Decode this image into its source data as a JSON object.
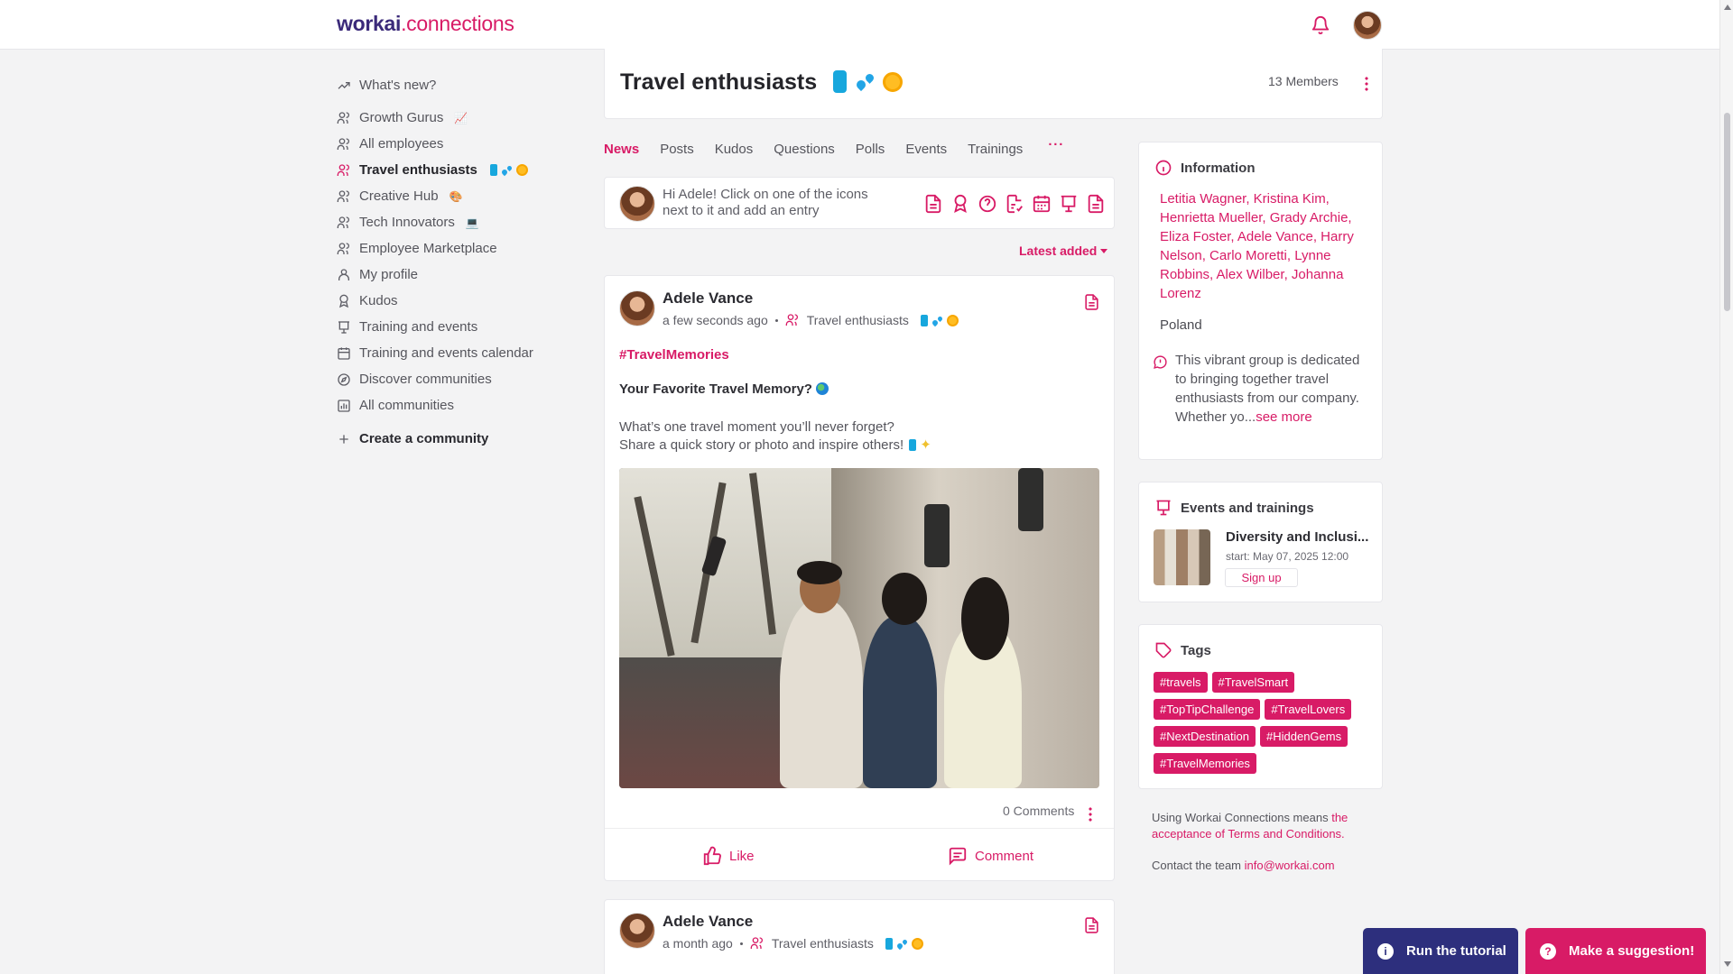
{
  "app": {
    "logo_primary": "workai",
    "logo_secondary": ".connections"
  },
  "header": {
    "icons": [
      "bell-icon",
      "user-avatar"
    ]
  },
  "sidebar": {
    "items": [
      {
        "label": "What's new?",
        "icon": "trend-icon"
      },
      {
        "label": "Growth Gurus",
        "icon": "group-icon",
        "emoji": "📈"
      },
      {
        "label": "All employees",
        "icon": "group-icon"
      },
      {
        "label": "Travel enthusiasts",
        "icon": "group-icon",
        "active": true
      },
      {
        "label": "Creative Hub",
        "icon": "group-icon",
        "emoji": "🎨"
      },
      {
        "label": "Tech Innovators",
        "icon": "group-icon",
        "emoji": "💻"
      },
      {
        "label": "Employee Marketplace",
        "icon": "group-icon"
      },
      {
        "label": "My profile",
        "icon": "user-icon"
      },
      {
        "label": "Kudos",
        "icon": "award-icon"
      },
      {
        "label": "Training and events",
        "icon": "presentation-icon"
      },
      {
        "label": "Training and events calendar",
        "icon": "calendar-icon"
      },
      {
        "label": "Discover communities",
        "icon": "compass-icon"
      },
      {
        "label": "All communities",
        "icon": "chart-icon"
      }
    ],
    "create_label": "Create a community"
  },
  "group": {
    "title": "Travel enthusiasts",
    "members": "13 Members"
  },
  "tabs": [
    "News",
    "Posts",
    "Kudos",
    "Questions",
    "Polls",
    "Events",
    "Trainings",
    "···"
  ],
  "composer": {
    "prompt": "Hi Adele! Click on one of the icons next to it and add an entry"
  },
  "sort": {
    "label": "Latest added"
  },
  "post": {
    "author": "Adele Vance",
    "time": "a few seconds ago",
    "group": "Travel enthusiasts",
    "hashtag": "#TravelMemories",
    "heading": "Your Favorite Travel Memory?",
    "body_line_1": "What’s one travel moment you’ll never forget?",
    "body_line_2": "Share a quick story or photo and inspire others!",
    "comments": "0 Comments",
    "like_label": "Like",
    "comment_label": "Comment"
  },
  "post_2": {
    "author": "Adele Vance",
    "time": "a month ago",
    "group": "Travel enthusiasts"
  },
  "information": {
    "title": "Information",
    "members": "Letitia Wagner, Kristina Kim, Henrietta Mueller, Grady Archie, Eliza Foster, Adele Vance, Harry Nelson, Carlo Moretti, Lynne Robbins, Alex Wilber, Johanna Lorenz",
    "country": "Poland",
    "description": "This vibrant group is dedicated to bringing together travel enthusiasts from our company. Whether yo...",
    "see_more": "see more"
  },
  "events": {
    "title": "Events and trainings",
    "event_title": "Diversity and Inclusi...",
    "event_date": "start: May 07, 2025 12:00",
    "signup_label": "Sign up"
  },
  "tags": {
    "title": "Tags",
    "items": [
      "#travels",
      "#TravelSmart",
      "#TopTipChallenge",
      "#TravelLovers",
      "#NextDestination",
      "#HiddenGems",
      "#TravelMemories"
    ]
  },
  "footer": {
    "terms_prefix": "Using Workai Connections means",
    "terms_link": "the acceptance of Terms and Conditions.",
    "contact_prefix": "Contact the team",
    "contact_email": "info@workai.com"
  },
  "floating_actions": {
    "tutorial_label": "Run the tutorial",
    "suggestion_label": "Make a suggestion!"
  },
  "colors": {
    "accent": "#d81b66",
    "navy": "#2d2f7d",
    "background": "#f3f3f4"
  }
}
